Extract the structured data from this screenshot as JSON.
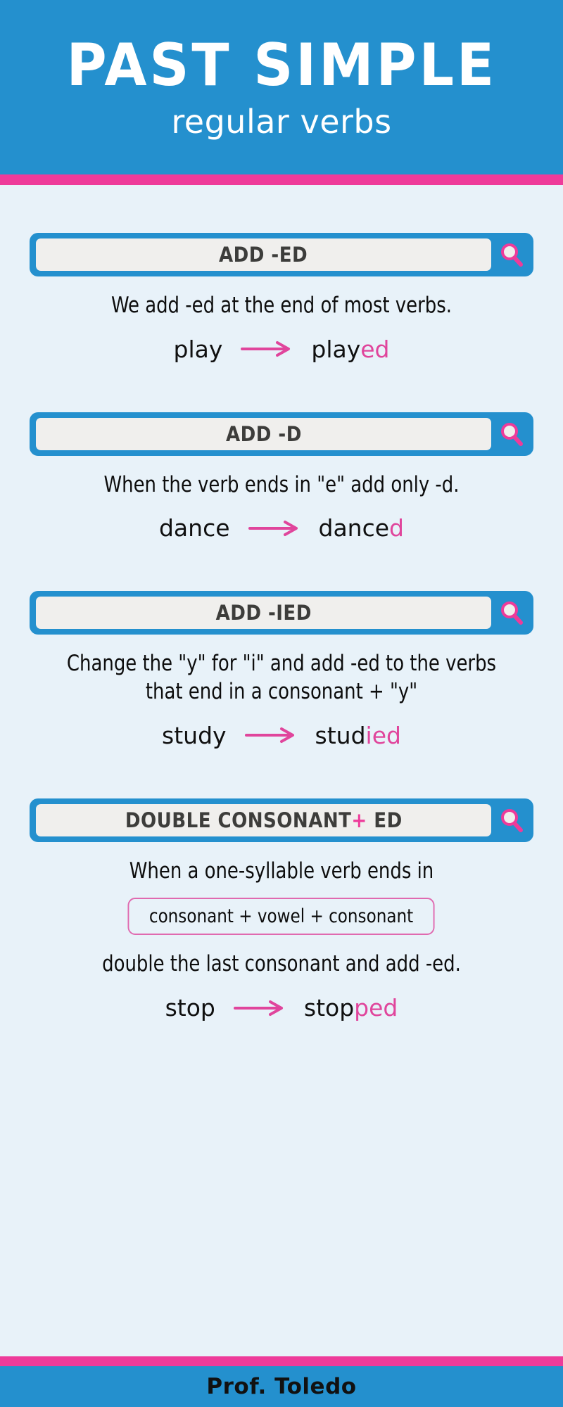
{
  "header": {
    "title": "PAST SIMPLE",
    "subtitle": "regular verbs",
    "bg_color": "#2490ce",
    "accent_color": "#ee3b9a"
  },
  "theme": {
    "blue": "#2490ce",
    "pink": "#ee3b9a",
    "suffix_pink": "#e0459c",
    "page_bg": "#e8f2f9",
    "field_bg": "#f0efed",
    "field_text": "#3d3d3b"
  },
  "rules": [
    {
      "bar_label": "ADD -ED",
      "bar_label_plus": "",
      "bar_label_tail": "",
      "search_icon": "magnifier-icon",
      "description": "We add -ed at the end of most verbs.",
      "example": {
        "base": "play",
        "arrow": "arrow-right-icon",
        "stem": "play",
        "suffix": "ed"
      }
    },
    {
      "bar_label": "ADD -D",
      "bar_label_plus": "",
      "bar_label_tail": "",
      "search_icon": "magnifier-icon",
      "description": "When the verb ends in \"e\" add only -d.",
      "example": {
        "base": "dance",
        "arrow": "arrow-right-icon",
        "stem": "dance",
        "suffix": "d"
      }
    },
    {
      "bar_label": "ADD -IED",
      "bar_label_plus": "",
      "bar_label_tail": "",
      "search_icon": "magnifier-icon",
      "description": "Change the \"y\" for \"i\" and add -ed to the verbs that end in a consonant + \"y\"",
      "example": {
        "base": "study",
        "arrow": "arrow-right-icon",
        "stem": "stud",
        "suffix": "ied"
      }
    },
    {
      "bar_label": "DOUBLE CONSONANT",
      "bar_label_plus": "+",
      "bar_label_tail": " ED",
      "search_icon": "magnifier-icon",
      "description": "When a one-syllable verb ends in",
      "cvc_box": "consonant + vowel + consonant",
      "description2": "double the last consonant and add -ed.",
      "example": {
        "base": "stop",
        "arrow": "arrow-right-icon",
        "stem": "stop",
        "suffix": "ped"
      }
    }
  ],
  "footer": {
    "author": "Prof. Toledo"
  }
}
